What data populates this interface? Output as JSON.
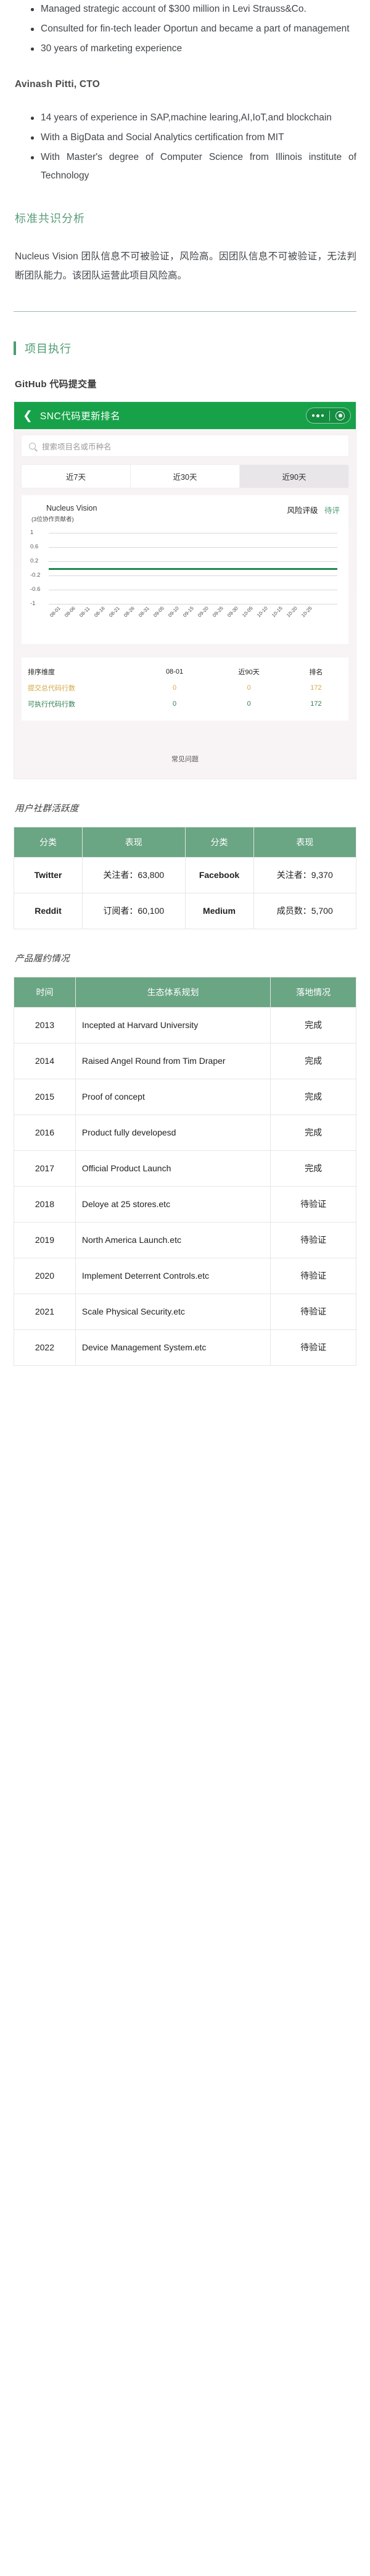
{
  "team": {
    "cmo_bullets": [
      "Managed strategic account of $300 million in Levi Strauss&Co.",
      "Consulted for fin-tech leader Oportun and became a part of management",
      "30 years of marketing experience"
    ],
    "cto_name": "Avinash Pitti,  CTO",
    "cto_bullets": [
      "14 years of experience in SAP,machine learing,AI,IoT,and blockchain",
      "With a BigData and Social Analytics certification from MIT",
      "With Master's degree of Computer Science from Illinois institute of Technology"
    ]
  },
  "consensus": {
    "heading": "标准共识分析",
    "paragraph": "Nucleus Vision 团队信息不可被验证，风险高。因团队信息不可被验证，无法判断团队能力。该团队运营此项目风险高。"
  },
  "execution": {
    "heading": "项目执行",
    "github_subtitle": "GitHub 代码提交量"
  },
  "appshot": {
    "navbar": {
      "back_icon": "chevron-left-icon",
      "title": "SNC代码更新排名",
      "more_icon": "more-dots-icon",
      "target_icon": "target-icon"
    },
    "search": {
      "icon": "search-icon",
      "placeholder": "搜索项目名或币种名"
    },
    "tabs": [
      {
        "label": "近7天",
        "active": false
      },
      {
        "label": "近30天",
        "active": false
      },
      {
        "label": "近90天",
        "active": true
      }
    ],
    "card": {
      "project": "Nucleus Vision",
      "contributors": "(3位协作贡献者)",
      "risk_label": "风险评级",
      "risk_value": "待评"
    },
    "rank_table": {
      "headers": [
        "排序维度",
        "08-01",
        "近90天",
        "排名"
      ],
      "rows": [
        {
          "label": "提交总代码行数",
          "values": [
            "0",
            "0",
            "172"
          ]
        },
        {
          "label": "可执行代码行数",
          "values": [
            "0",
            "0",
            "172"
          ]
        }
      ]
    },
    "faq_label": "常见问题"
  },
  "chart_data": {
    "type": "line",
    "title": "Nucleus Vision",
    "subtitle": "(3位协作贡献者)",
    "xlabel": "",
    "ylabel": "",
    "ylim": [
      -1,
      1
    ],
    "yticks": [
      "1",
      "0.6",
      "0.2",
      "-0.2",
      "-0.6",
      "-1"
    ],
    "grid": true,
    "legend": "none",
    "line_color": "#1d8a4e",
    "x": [
      "08-01",
      "08-06",
      "08-11",
      "08-16",
      "08-21",
      "08-26",
      "08-31",
      "09-05",
      "09-10",
      "09-15",
      "09-20",
      "09-25",
      "09-30",
      "10-05",
      "10-10",
      "10-15",
      "10-20",
      "10-25"
    ],
    "series": [
      {
        "name": "代码提交量",
        "values": [
          0,
          0,
          0,
          0,
          0,
          0,
          0,
          0,
          0,
          0,
          0,
          0,
          0,
          0,
          0,
          0,
          0,
          0
        ]
      }
    ]
  },
  "social": {
    "heading": "用户社群活跃度",
    "headers": [
      "分类",
      "表现",
      "分类",
      "表现"
    ],
    "rows": [
      [
        "Twitter",
        "关注者：63,800",
        "Facebook",
        "关注者：9,370"
      ],
      [
        "Reddit",
        "订阅者：60,100",
        "Medium",
        "成员数：5,700"
      ]
    ]
  },
  "roadmap": {
    "heading": "产品履约情况",
    "headers": [
      "时间",
      "生态体系规划",
      "落地情况"
    ],
    "rows": [
      [
        "2013",
        "Incepted at Harvard University",
        "完成"
      ],
      [
        "2014",
        "Raised Angel Round from Tim Draper",
        "完成"
      ],
      [
        "2015",
        "Proof of concept",
        "完成"
      ],
      [
        "2016",
        "Product fully developesd",
        "完成"
      ],
      [
        "2017",
        "Official Product Launch",
        "完成"
      ],
      [
        "2018",
        "Deloye at 25 stores.etc",
        "待验证"
      ],
      [
        "2019",
        "North America Launch.etc",
        "待验证"
      ],
      [
        "2020",
        "Implement Deterrent Controls.etc",
        "待验证"
      ],
      [
        "2021",
        "Scale Physical Security.etc",
        "待验证"
      ],
      [
        "2022",
        "Device Management System.etc",
        "待验证"
      ]
    ]
  }
}
